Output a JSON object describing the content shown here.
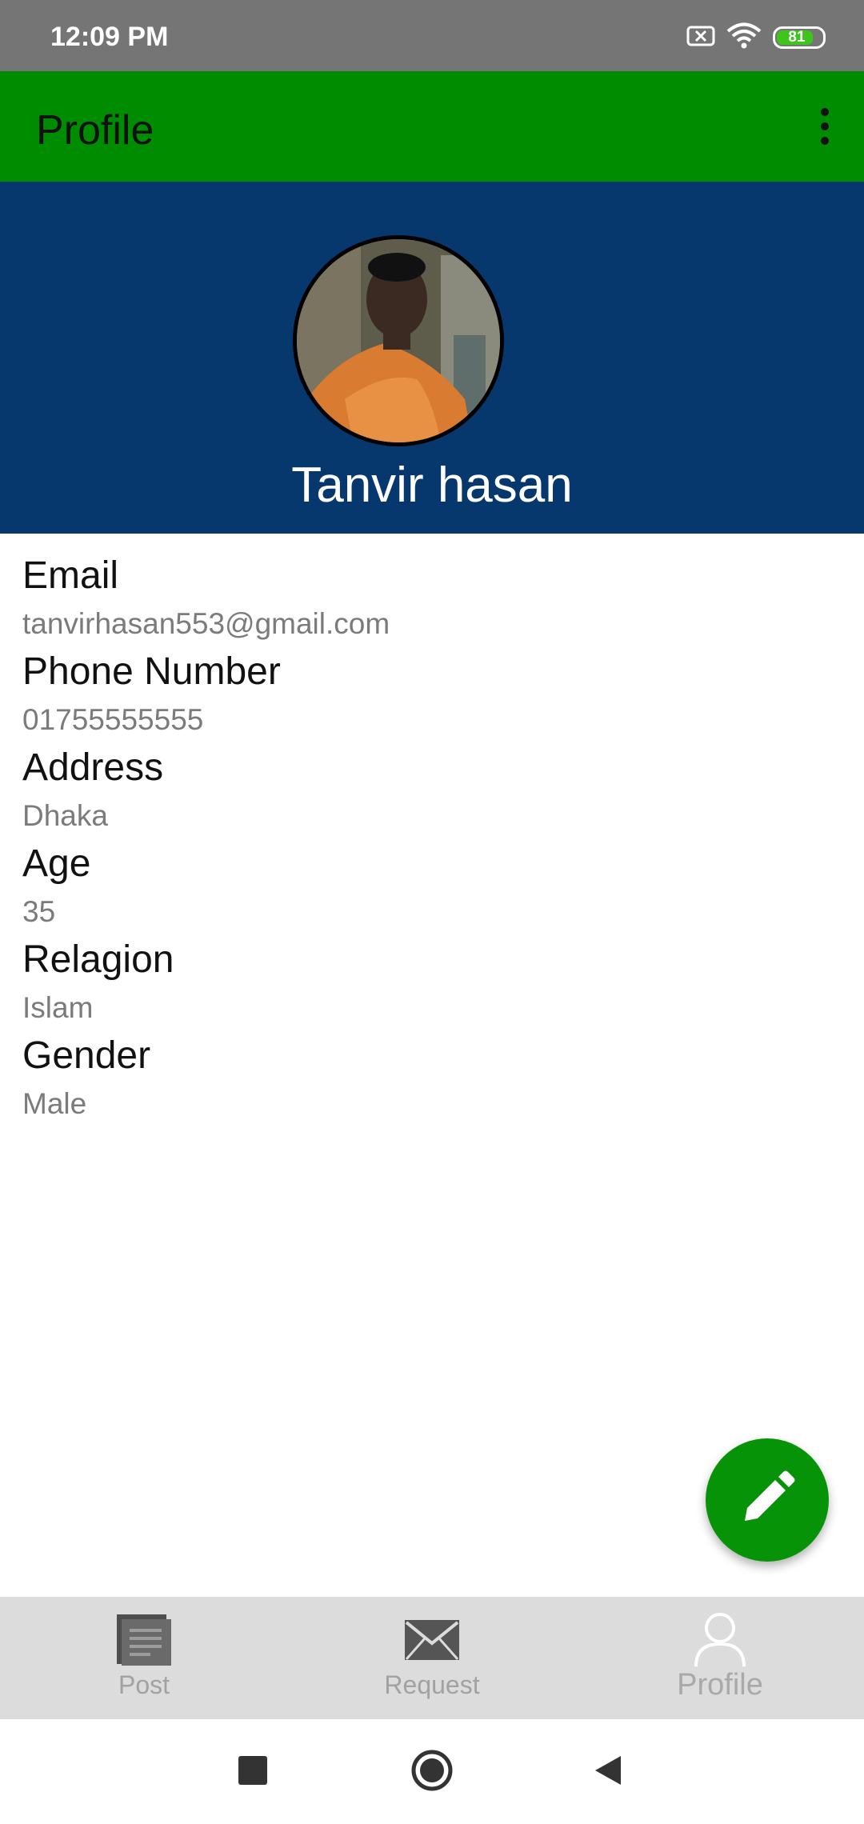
{
  "status_bar": {
    "time": "12:09 PM",
    "battery_level": "81",
    "battery_fraction": 0.81
  },
  "app_bar": {
    "title": "Profile",
    "overflow_icon": "more-vert-icon"
  },
  "profile": {
    "name": "Tanvir hasan",
    "avatar_icon": "profile-photo"
  },
  "fields": [
    {
      "label": "Email",
      "value": "tanvirhasan553@gmail.com"
    },
    {
      "label": "Phone Number",
      "value": "01755555555"
    },
    {
      "label": "Address",
      "value": "Dhaka"
    },
    {
      "label": "Age",
      "value": "35"
    },
    {
      "label": "Relagion",
      "value": "Islam"
    },
    {
      "label": "Gender",
      "value": "Male"
    }
  ],
  "fab": {
    "icon": "edit-pencil-icon",
    "color": "#079307"
  },
  "bottom_nav": {
    "items": [
      {
        "label": "Post",
        "icon": "post-icon"
      },
      {
        "label": "Request",
        "icon": "mail-icon"
      },
      {
        "label": "Profile",
        "icon": "person-icon"
      }
    ],
    "active_index": 2
  },
  "colors": {
    "app_bar": "#008c00",
    "header": "#06386e",
    "status_bar": "#757575"
  }
}
